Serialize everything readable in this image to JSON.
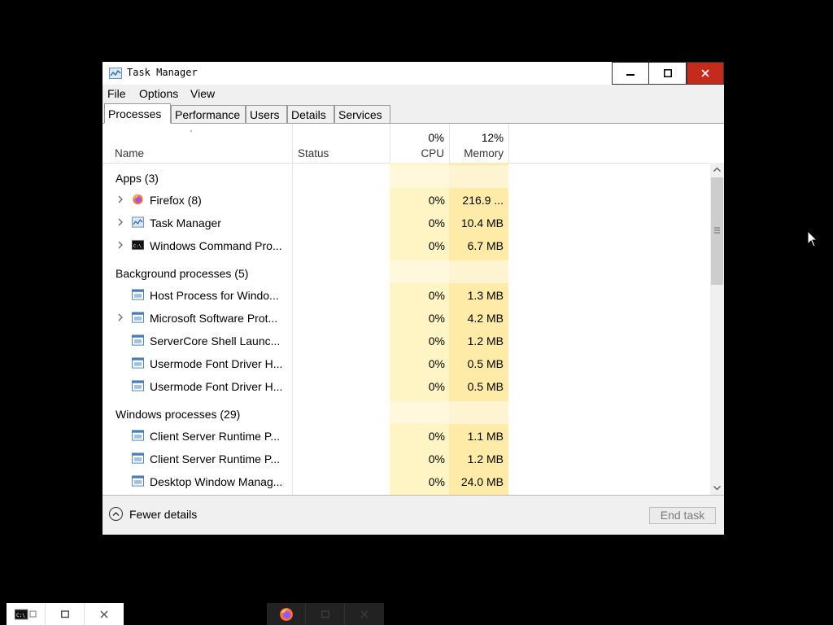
{
  "window": {
    "title": "Task Manager"
  },
  "menu": [
    "File",
    "Options",
    "View"
  ],
  "tabs": [
    "Processes",
    "Performance",
    "Users",
    "Details",
    "Services"
  ],
  "active_tab": "Processes",
  "columns": {
    "name": "Name",
    "status": "Status",
    "cpu_pct": "0%",
    "cpu": "CPU",
    "mem_pct": "12%",
    "mem": "Memory"
  },
  "groups": [
    {
      "title": "Apps (3)",
      "items": [
        {
          "name": "Firefox (8)",
          "cpu": "0%",
          "mem": "216.9 ...",
          "expandable": true,
          "icon": "firefox-icon"
        },
        {
          "name": "Task Manager",
          "cpu": "0%",
          "mem": "10.4 MB",
          "expandable": true,
          "icon": "task-manager-icon"
        },
        {
          "name": "Windows Command Pro...",
          "cpu": "0%",
          "mem": "6.7 MB",
          "expandable": true,
          "icon": "cmd-icon"
        }
      ]
    },
    {
      "title": "Background processes (5)",
      "items": [
        {
          "name": "Host Process for Windo...",
          "cpu": "0%",
          "mem": "1.3 MB",
          "expandable": false,
          "icon": "process-icon"
        },
        {
          "name": "Microsoft Software Prot...",
          "cpu": "0%",
          "mem": "4.2 MB",
          "expandable": true,
          "icon": "process-icon"
        },
        {
          "name": "ServerCore Shell Launc...",
          "cpu": "0%",
          "mem": "1.2 MB",
          "expandable": false,
          "icon": "process-icon"
        },
        {
          "name": "Usermode Font Driver H...",
          "cpu": "0%",
          "mem": "0.5 MB",
          "expandable": false,
          "icon": "process-icon"
        },
        {
          "name": "Usermode Font Driver H...",
          "cpu": "0%",
          "mem": "0.5 MB",
          "expandable": false,
          "icon": "process-icon"
        }
      ]
    },
    {
      "title": "Windows processes (29)",
      "items": [
        {
          "name": "Client Server Runtime P...",
          "cpu": "0%",
          "mem": "1.1 MB",
          "expandable": false,
          "icon": "process-icon"
        },
        {
          "name": "Client Server Runtime P...",
          "cpu": "0%",
          "mem": "1.2 MB",
          "expandable": false,
          "icon": "process-icon"
        },
        {
          "name": "Desktop Window Manag...",
          "cpu": "0%",
          "mem": "24.0 MB",
          "expandable": false,
          "icon": "process-icon"
        }
      ]
    }
  ],
  "footer": {
    "fewer_details": "Fewer details",
    "end_task": "End task"
  }
}
